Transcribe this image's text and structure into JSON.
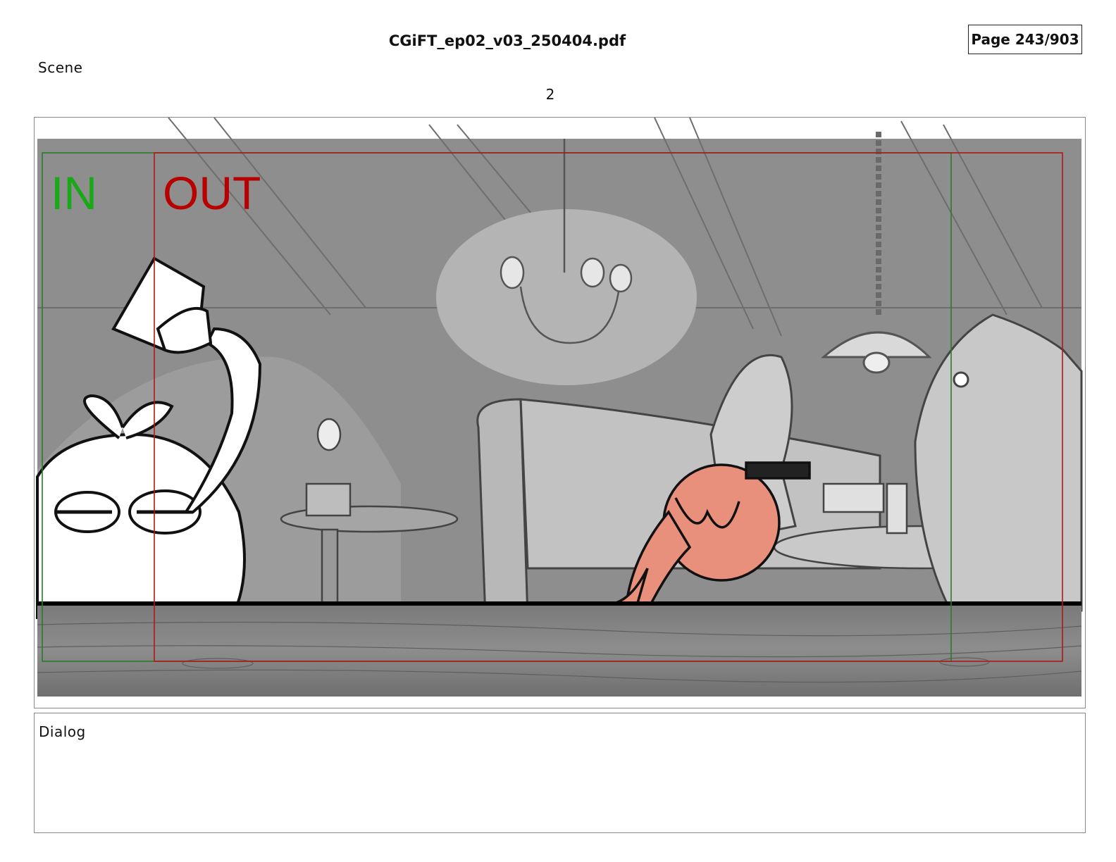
{
  "header": {
    "file_title": "CGiFT_ep02_v03_250404.pdf",
    "page_indicator": "Page 243/903"
  },
  "scene": {
    "label": "Scene",
    "number": "2"
  },
  "panel": {
    "in_label": "IN",
    "out_label": "OUT",
    "in_color": "#18a818",
    "out_color": "#b80000",
    "character_color": "#e8907c"
  },
  "dialog": {
    "label": "Dialog",
    "text": ""
  }
}
